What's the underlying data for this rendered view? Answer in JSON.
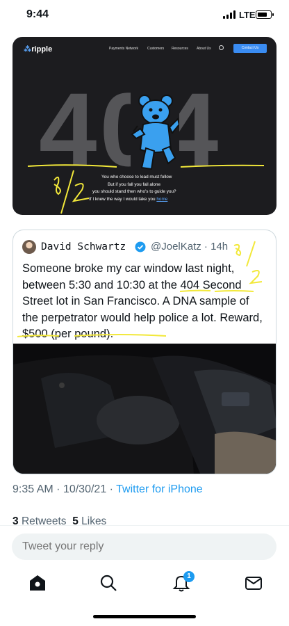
{
  "status_bar": {
    "time": "9:44",
    "network": "LTE",
    "battery_level": 0.8
  },
  "embedded_image": {
    "logo": "ripple",
    "nav_links": [
      "Payments Network",
      "Customers",
      "Resources",
      "About Us"
    ],
    "search_icon": "search-icon",
    "cta": "Contact Us",
    "error_code": "404",
    "message_lines": [
      "You who choose to lead must follow",
      "But if you fall you fall alone",
      "you should stand then who's to guide you?",
      "If I knew the way I would take you"
    ],
    "home_link": "home",
    "handwritten_note": "8/2",
    "colors": {
      "background": "#1c1c1f",
      "digits": "#555558",
      "bear": "#3aa0ef",
      "link": "#5ca8ff",
      "scribble": "#f2e83a"
    }
  },
  "quoted_tweet": {
    "name": "David Schwartz",
    "handle": "@JoelKatz",
    "age": "14h",
    "verified_icon": "verified-badge-icon",
    "text": "Someone broke my car window last night, between 5:30 and 10:30 at the 404 Second Street lot in San Francisco. A DNA sample of the perpetrator would help police a lot. Reward, $500 (per pound).",
    "handwritten_note": "8/2",
    "media_alt": "car-interior-photo"
  },
  "tweet_meta": {
    "time": "9:35 AM",
    "date": "10/30/21",
    "separator": "·",
    "source": "Twitter for iPhone"
  },
  "stats": {
    "retweets_count": "3",
    "retweets_label": "Retweets",
    "likes_count": "5",
    "likes_label": "Likes"
  },
  "reply": {
    "placeholder": "Tweet your reply"
  },
  "tab_bar": {
    "items": [
      "home-icon",
      "search-icon",
      "notifications-icon",
      "messages-icon"
    ],
    "notification_badge": "1"
  },
  "colors": {
    "accent": "#1d9bf0",
    "secondary_text": "#536471",
    "border": "#cfd9de"
  }
}
